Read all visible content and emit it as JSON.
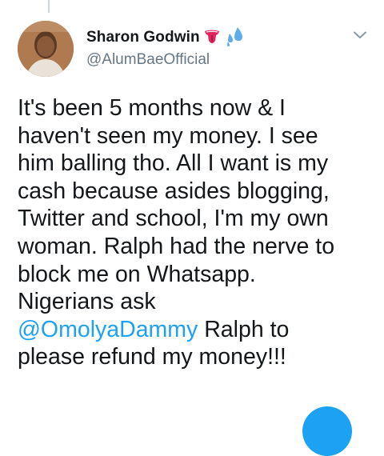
{
  "user": {
    "display_name": "Sharon Godwin",
    "handle": "@AlumBaeOfficial",
    "name_emojis": [
      "tongue-emoji",
      "sweat-droplets-emoji"
    ]
  },
  "tweet": {
    "text_part1": "It's been 5 months now & I\nhaven't seen my money. I see\nhim balling tho. All I want is my\ncash because asides blogging,\nTwitter and school, I'm my own\nwoman. Ralph had the nerve to\nblock me on Whatsapp.\nNigerians ask\n",
    "mention": "@OmolyaDammy",
    "text_part2": " Ralph to\nplease refund my money!!!"
  },
  "colors": {
    "accent": "#1da1f2",
    "text": "#14171a",
    "secondary": "#657786"
  },
  "icons": {
    "more": "chevron-down-icon",
    "compose": "compose-fab"
  }
}
